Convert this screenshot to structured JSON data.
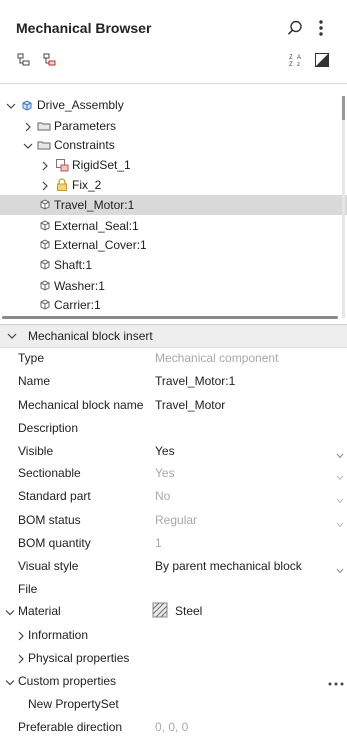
{
  "header": {
    "title": "Mechanical Browser",
    "icons": [
      "search-icon",
      "more-vert-icon",
      "tree-expand-icon",
      "tree-filter-icon",
      "sort-icon",
      "contrast-icon"
    ]
  },
  "tree": {
    "items": [
      {
        "label": "Drive_Assembly",
        "icon": "assembly-icon",
        "expanded": true
      },
      {
        "label": "Parameters",
        "icon": "folder-icon",
        "expanded": false
      },
      {
        "label": "Constraints",
        "icon": "folder-icon",
        "expanded": true
      },
      {
        "label": "RigidSet_1",
        "icon": "rigidset-icon",
        "expanded": false
      },
      {
        "label": "Fix_2",
        "icon": "lock-icon",
        "expanded": false
      },
      {
        "label": "Travel_Motor:1",
        "icon": "component-icon",
        "selected": true
      },
      {
        "label": "External_Seal:1",
        "icon": "component-icon"
      },
      {
        "label": "External_Cover:1",
        "icon": "component-icon"
      },
      {
        "label": "Shaft:1",
        "icon": "component-icon"
      },
      {
        "label": "Washer:1",
        "icon": "component-icon"
      },
      {
        "label": "Carrier:1",
        "icon": "component-icon"
      }
    ]
  },
  "panel": {
    "title": "Mechanical block insert",
    "properties": [
      {
        "label": "Type",
        "value": "Mechanical component",
        "dim": true
      },
      {
        "label": "Name",
        "value": "Travel_Motor:1"
      },
      {
        "label": "Mechanical block name",
        "value": "Travel_Motor"
      },
      {
        "label": "Description",
        "value": ""
      },
      {
        "label": "Visible",
        "value": "Yes",
        "dropdown": true
      },
      {
        "label": "Sectionable",
        "value": "Yes",
        "dim": true,
        "dropdown": true
      },
      {
        "label": "Standard part",
        "value": "No",
        "dim": true,
        "dropdown": true
      },
      {
        "label": "BOM status",
        "value": "Regular",
        "dim": true,
        "dropdown": true
      },
      {
        "label": "BOM quantity",
        "value": "1",
        "dim": true
      },
      {
        "label": "Visual style",
        "value": "By parent mechanical block",
        "dropdown": true
      },
      {
        "label": "File",
        "value": ""
      }
    ],
    "material": {
      "label": "Material",
      "value": "Steel"
    },
    "information": "Information",
    "physical": "Physical properties",
    "custom": "Custom properties",
    "new_propertyset": "New PropertySet",
    "preferable": {
      "label": "Preferable direction",
      "value": "0, 0, 0"
    }
  }
}
